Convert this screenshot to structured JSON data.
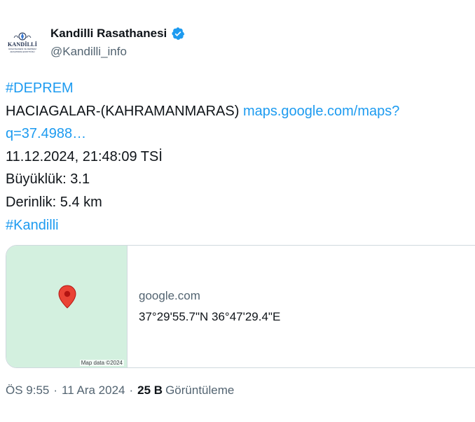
{
  "author": {
    "display_name": "Kandilli Rasathanesi",
    "handle": "@Kandilli_info",
    "avatar_logo_text": "KANDİLLİ",
    "avatar_logo_sub": "RASATHANESİ VE DEPREM ARAŞTIRMA ENSTİTÜSÜ",
    "verified": true,
    "verified_color": "#1d9bf0"
  },
  "tweet": {
    "hashtag_1": "#DEPREM",
    "location_text": "HACIAGALAR-(KAHRAMANMARAS) ",
    "link_part_1": "maps.google.com/maps?",
    "link_part_2": "q=37.4988…",
    "datetime": "11.12.2024, 21:48:09 TSİ",
    "magnitude": "Büyüklük: 3.1",
    "depth": "Derinlik: 5.4 km",
    "hashtag_2": "#Kandilli",
    "link_color": "#1d9bf0"
  },
  "card": {
    "map_credit": "Map data ©2024",
    "domain": "google.com",
    "coordinates": "37°29'55.7\"N 36°47'29.4\"E",
    "pin_icon": "map-pin-icon",
    "map_color": "#d3f0df"
  },
  "meta": {
    "time": "ÖS 9:55",
    "separator": "·",
    "date": "11 Ara 2024",
    "views_count": "25 B",
    "views_label": "Görüntüleme"
  }
}
